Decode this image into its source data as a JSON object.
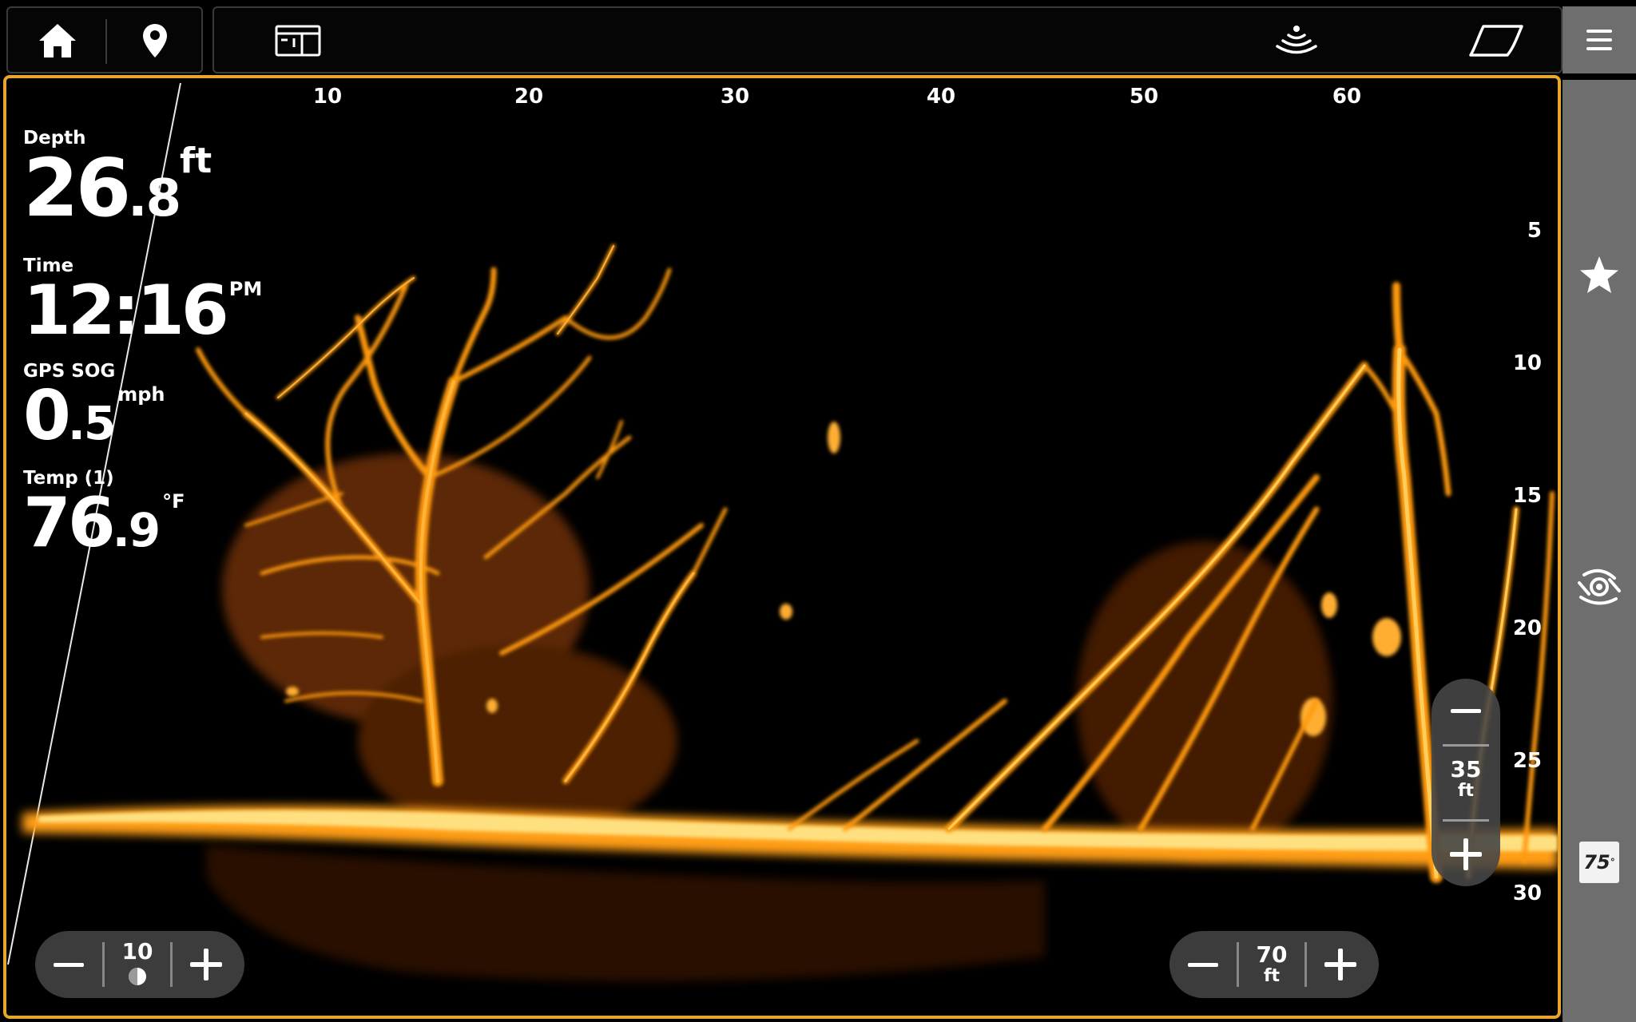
{
  "toolbar": {
    "home_icon": "home-icon",
    "waypoint_icon": "map-pin-icon",
    "layout_icon": "split-view-icon",
    "sonar_icon": "sonar-transducer-icon",
    "chart_icon": "chart-view-icon",
    "menu_icon": "hamburger-menu-icon"
  },
  "sidebar": {
    "favorite_icon": "star-icon",
    "sonar_mode_icon": "live-sonar-icon",
    "temp_badge": {
      "value": "75",
      "unit": "°"
    }
  },
  "sonar": {
    "x_ticks": [
      "10",
      "20",
      "30",
      "40",
      "50",
      "60"
    ],
    "y_ticks": [
      "5",
      "10",
      "15",
      "20",
      "25",
      "30"
    ],
    "accent_color": "#e8a72a",
    "echo_color": "#ff9a10"
  },
  "readouts": {
    "depth": {
      "label": "Depth",
      "int": "26",
      "dec": ".8",
      "unit": "ft"
    },
    "time": {
      "label": "Time",
      "value": "12:16",
      "suffix": "PM"
    },
    "sog": {
      "label": "GPS SOG",
      "int": "0",
      "dec": ".5",
      "unit": "mph"
    },
    "temp": {
      "label": "Temp (1)",
      "int": "76",
      "dec": ".9",
      "unit": "°F"
    }
  },
  "controls": {
    "gain": {
      "value": "10"
    },
    "range": {
      "value": "35",
      "unit": "ft"
    },
    "forward_range": {
      "value": "70",
      "unit": "ft"
    }
  }
}
